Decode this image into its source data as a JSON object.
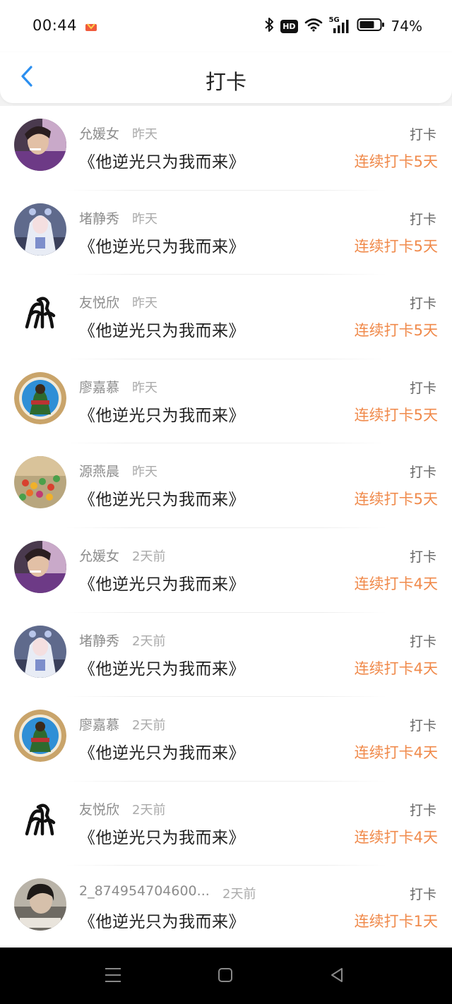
{
  "status_bar": {
    "time": "00:44",
    "icons": [
      "app-notification-icon",
      "bluetooth-icon",
      "hd-icon",
      "wifi-icon",
      "5g-signal-icon",
      "battery-icon"
    ],
    "hd_label": "HD",
    "network_label": "5G",
    "battery_percent": "74%",
    "battery_level": 0.74
  },
  "header": {
    "title": "打卡",
    "back_icon": "chevron-left-icon",
    "accent_color": "#2b8ff0"
  },
  "colors": {
    "streak": "#f08a4b"
  },
  "checkins": [
    {
      "user": "允媛女",
      "time": "昨天",
      "book": "《他逆光只为我而来》",
      "label": "打卡",
      "streak": "连续打卡5天",
      "avatar": "photo-man"
    },
    {
      "user": "堵静秀",
      "time": "昨天",
      "book": "《他逆光只为我而来》",
      "label": "打卡",
      "streak": "连续打卡5天",
      "avatar": "anime-girl"
    },
    {
      "user": "友悦欣",
      "time": "昨天",
      "book": "《他逆光只为我而来》",
      "label": "打卡",
      "streak": "连续打卡5天",
      "avatar": "glyph-logo"
    },
    {
      "user": "廖嘉慕",
      "time": "昨天",
      "book": "《他逆光只为我而来》",
      "label": "打卡",
      "streak": "连续打卡5天",
      "avatar": "medallion"
    },
    {
      "user": "源燕晨",
      "time": "昨天",
      "book": "《他逆光只为我而来》",
      "label": "打卡",
      "streak": "连续打卡5天",
      "avatar": "candy"
    },
    {
      "user": "允媛女",
      "time": "2天前",
      "book": "《他逆光只为我而来》",
      "label": "打卡",
      "streak": "连续打卡4天",
      "avatar": "photo-man"
    },
    {
      "user": "堵静秀",
      "time": "2天前",
      "book": "《他逆光只为我而来》",
      "label": "打卡",
      "streak": "连续打卡4天",
      "avatar": "anime-girl"
    },
    {
      "user": "廖嘉慕",
      "time": "2天前",
      "book": "《他逆光只为我而来》",
      "label": "打卡",
      "streak": "连续打卡4天",
      "avatar": "medallion"
    },
    {
      "user": "友悦欣",
      "time": "2天前",
      "book": "《他逆光只为我而来》",
      "label": "打卡",
      "streak": "连续打卡4天",
      "avatar": "glyph-logo"
    },
    {
      "user": "2_874954704600...",
      "time": "2天前",
      "book": "《他逆光只为我而来》",
      "label": "打卡",
      "streak": "连续打卡1天",
      "avatar": "photo-child"
    }
  ],
  "nav_bar": {
    "buttons": [
      "menu-icon",
      "home-icon",
      "back-triangle-icon"
    ]
  }
}
